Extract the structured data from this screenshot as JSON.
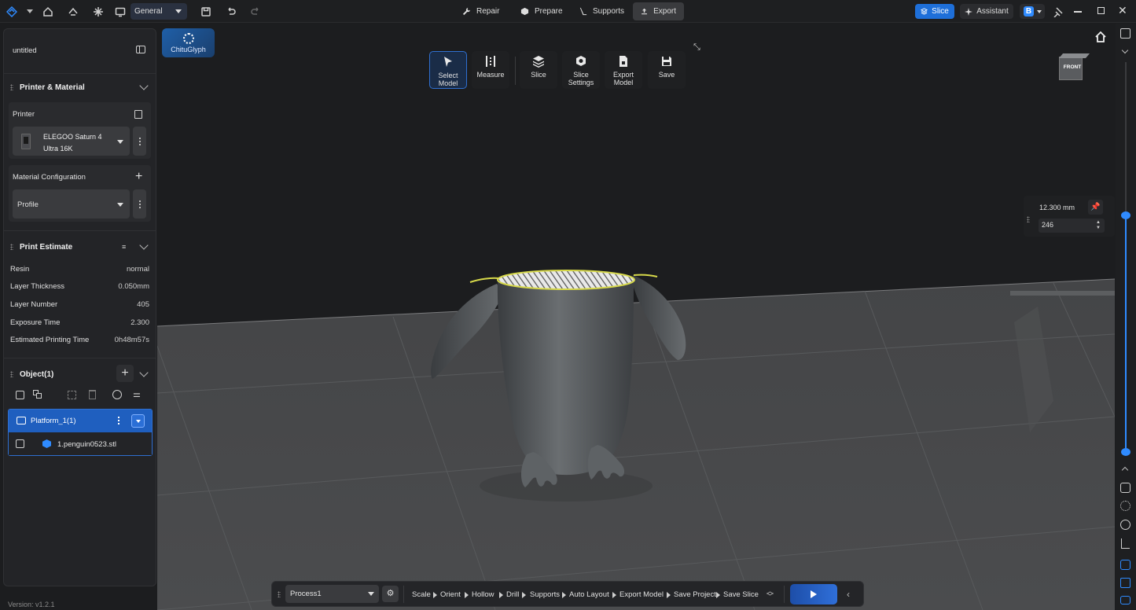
{
  "topbar": {
    "workspace": "General",
    "tabs": [
      {
        "label": "Repair",
        "icon": "wrench-icon"
      },
      {
        "label": "Prepare",
        "icon": "cube-icon"
      },
      {
        "label": "Supports",
        "icon": "support-icon"
      },
      {
        "label": "Export",
        "icon": "export-icon",
        "active": true
      }
    ],
    "slice_label": "Slice",
    "assistant_label": "Assistant"
  },
  "brand": {
    "name": "ChituGlyph"
  },
  "project": {
    "name": "untitled"
  },
  "printer_material": {
    "section_title": "Printer & Material",
    "printer_label": "Printer",
    "printer_name": "ELEGOO Saturn 4 Ultra 16K",
    "material_label": "Material Configuration",
    "profile_value": "Profile"
  },
  "print_estimate": {
    "title": "Print Estimate",
    "rows": [
      {
        "label": "Resin",
        "value": "normal"
      },
      {
        "label": "Layer Thickness",
        "value": "0.050mm"
      },
      {
        "label": "Layer Number",
        "value": "405"
      },
      {
        "label": "Exposure Time",
        "value": "2.300"
      },
      {
        "label": "Estimated Printing Time",
        "value": "0h48m57s"
      }
    ]
  },
  "objects": {
    "title": "Object(1)",
    "platform_name": "Platform_1(1)",
    "items": [
      {
        "name": "1.penguin0523.stl"
      }
    ]
  },
  "viewport_tools": [
    {
      "label": "Select Model",
      "icon": "cursor-icon",
      "active": true
    },
    {
      "label": "Measure",
      "icon": "ruler-icon"
    },
    {
      "label": "Slice",
      "icon": "layers-icon"
    },
    {
      "label": "Slice Settings",
      "icon": "slice-settings-icon"
    },
    {
      "label": "Export Model",
      "icon": "export-model-icon"
    },
    {
      "label": "Save",
      "icon": "save-icon"
    }
  ],
  "viewcube": {
    "face": "FRONT"
  },
  "layer_slider": {
    "height_text": "12.300 mm",
    "layer_value": "246",
    "position_fraction": 0.607
  },
  "process": {
    "selected": "Process1",
    "steps": [
      "Scale",
      "Orient",
      "Hollow",
      "Drill",
      "Supports",
      "Auto Layout",
      "Export Model",
      "Save Project",
      "Save Slice"
    ]
  },
  "version": "Version: v1.2.1",
  "colors": {
    "accent": "#1e6fd9",
    "panel": "#232427",
    "highlight_outline": "#d7d94a"
  }
}
